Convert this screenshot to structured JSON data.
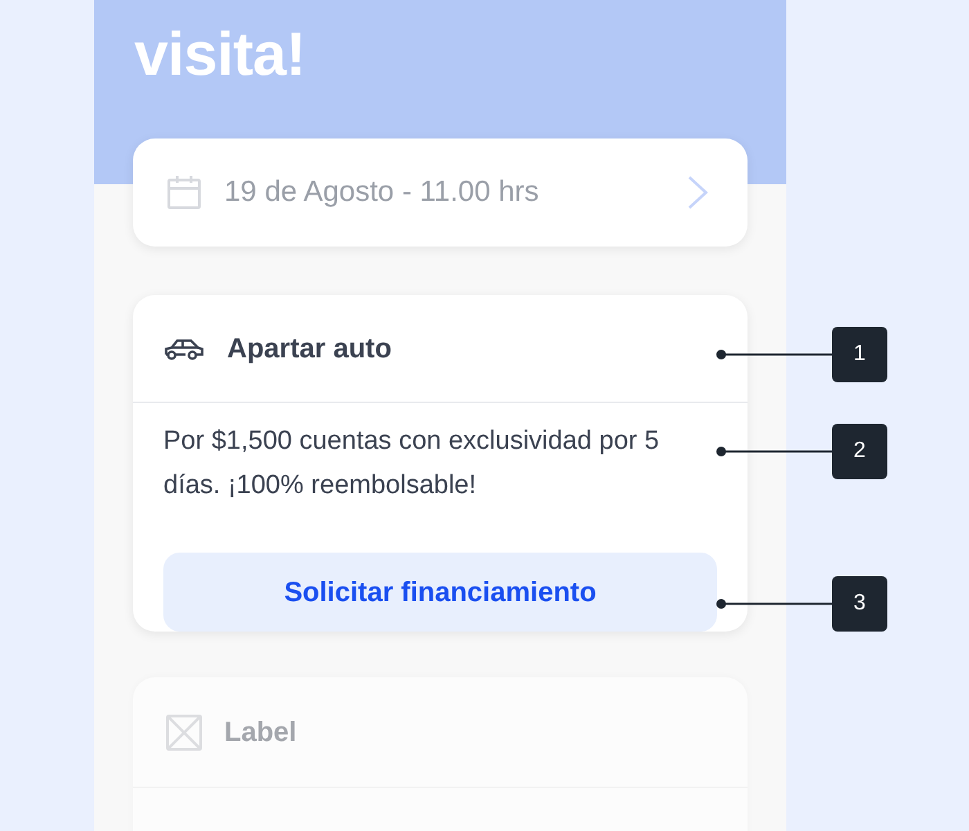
{
  "heading": "visita!",
  "date_card": {
    "text": "19 de Agosto - 11.00 hrs"
  },
  "reserve_card": {
    "title": "Apartar auto",
    "description": "Por $1,500 cuentas con exclusividad por 5 días. ¡100% reembolsable!",
    "button": "Solicitar financiamiento"
  },
  "placeholder_card": {
    "title": "Label"
  },
  "annotations": [
    "1",
    "2",
    "3"
  ]
}
